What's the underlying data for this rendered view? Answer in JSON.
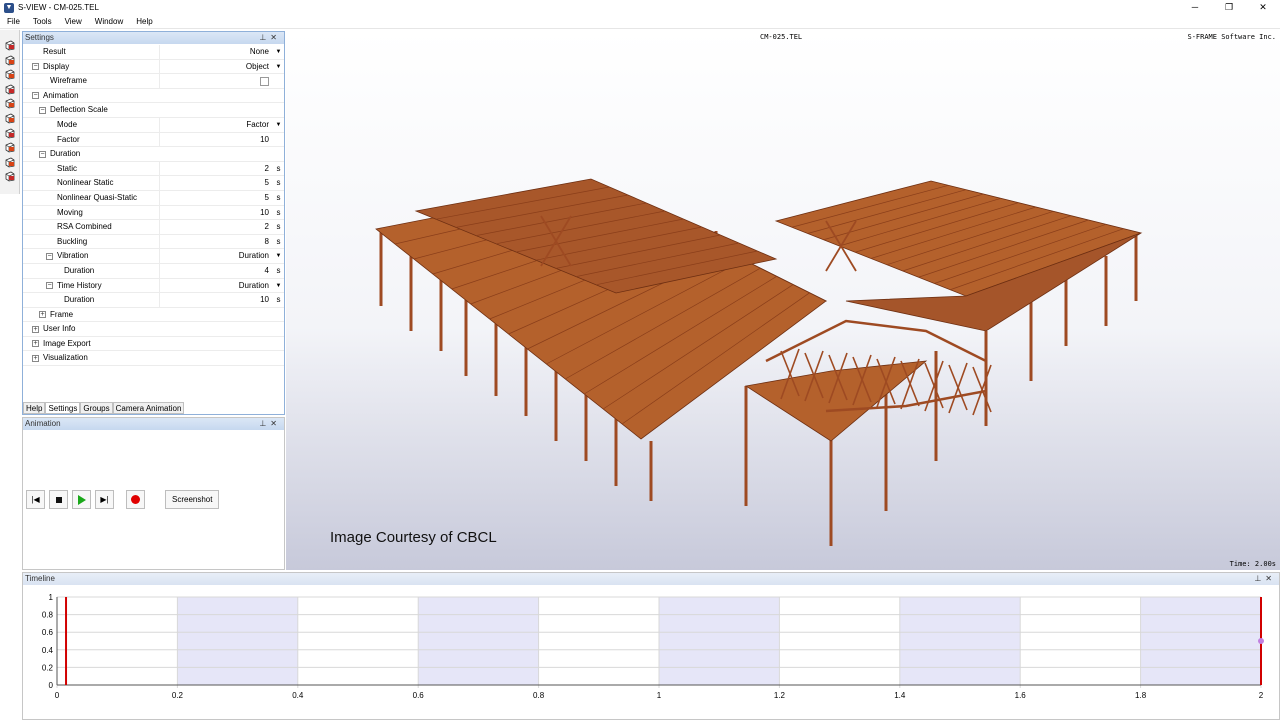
{
  "window": {
    "title": "S-VIEW - CM-025.TEL",
    "logo_icon": "sview-logo-icon"
  },
  "menu": [
    "File",
    "Tools",
    "View",
    "Window",
    "Help"
  ],
  "settings": {
    "title": "Settings",
    "rows": [
      {
        "name": "Result",
        "value": "None",
        "dropdown": true,
        "indent": 1,
        "type": "prop"
      },
      {
        "name": "Display",
        "value": "Object",
        "dropdown": true,
        "indent": 1,
        "type": "prop",
        "expander": "-"
      },
      {
        "name": "Wireframe",
        "value": "",
        "checkbox": true,
        "indent": 2,
        "type": "prop"
      },
      {
        "name": "Animation",
        "indent": 1,
        "type": "group",
        "expander": "-"
      },
      {
        "name": "Deflection Scale",
        "indent": 2,
        "type": "group",
        "expander": "-"
      },
      {
        "name": "Mode",
        "value": "Factor",
        "dropdown": true,
        "indent": 3,
        "type": "prop"
      },
      {
        "name": "Factor",
        "value": "10",
        "indent": 3,
        "type": "prop"
      },
      {
        "name": "Duration",
        "indent": 2,
        "type": "group",
        "expander": "-"
      },
      {
        "name": "Static",
        "value": "2",
        "unit": "s",
        "indent": 3,
        "type": "prop"
      },
      {
        "name": "Nonlinear Static",
        "value": "5",
        "unit": "s",
        "indent": 3,
        "type": "prop"
      },
      {
        "name": "Nonlinear Quasi-Static",
        "value": "5",
        "unit": "s",
        "indent": 3,
        "type": "prop"
      },
      {
        "name": "Moving",
        "value": "10",
        "unit": "s",
        "indent": 3,
        "type": "prop"
      },
      {
        "name": "RSA Combined",
        "value": "2",
        "unit": "s",
        "indent": 3,
        "type": "prop"
      },
      {
        "name": "Buckling",
        "value": "8",
        "unit": "s",
        "indent": 3,
        "type": "prop"
      },
      {
        "name": "Vibration",
        "value": "Duration",
        "dropdown": true,
        "indent": 3,
        "type": "prop",
        "expander": "-"
      },
      {
        "name": "Duration",
        "value": "4",
        "unit": "s",
        "indent": 4,
        "type": "prop"
      },
      {
        "name": "Time History",
        "value": "Duration",
        "dropdown": true,
        "indent": 3,
        "type": "prop",
        "expander": "-"
      },
      {
        "name": "Duration",
        "value": "10",
        "unit": "s",
        "indent": 4,
        "type": "prop"
      },
      {
        "name": "Frame",
        "indent": 2,
        "type": "group",
        "expander": "+"
      },
      {
        "name": "User Info",
        "indent": 1,
        "type": "group",
        "expander": "+"
      },
      {
        "name": "Image Export",
        "indent": 1,
        "type": "group",
        "expander": "+"
      },
      {
        "name": "Visualization",
        "indent": 1,
        "type": "group",
        "expander": "+"
      }
    ],
    "tabs": [
      "Help",
      "Settings",
      "Groups",
      "Camera Animation"
    ],
    "selected_tab": "Settings"
  },
  "animation": {
    "title": "Animation",
    "buttons": [
      "skip-to-start-icon",
      "stop-icon",
      "play-icon",
      "skip-to-end-icon",
      "record-icon"
    ],
    "screenshot_label": "Screenshot"
  },
  "viewport": {
    "file_label": "CM-025.TEL",
    "brand": "S-FRAME Software Inc.",
    "time": "Time: 2.00s",
    "credit": "Image Courtesy of CBCL"
  },
  "timeline": {
    "title": "Timeline",
    "x_ticks": [
      "0",
      "0.2",
      "0.4",
      "0.6",
      "0.8",
      "1",
      "1.2",
      "1.4",
      "1.6",
      "1.8",
      "2"
    ],
    "y_ticks": [
      "0",
      "0.2",
      "0.4",
      "0.6",
      "0.8",
      "1"
    ],
    "bands": [
      [
        0.2,
        0.4
      ],
      [
        0.6,
        0.8
      ],
      [
        1.0,
        1.2
      ],
      [
        1.4,
        1.6
      ],
      [
        1.8,
        2.0
      ]
    ],
    "marker_start": 0.015,
    "marker_end": 2.0,
    "point": {
      "x": 2.0,
      "y": 0.5
    }
  },
  "colors": {
    "band": "#e6e6f8",
    "marker": "#d10000",
    "steel": "#9e4a22",
    "deck": "#b4612c",
    "accent": "#8fb0d9",
    "point": "#c080e0",
    "play": "#1aa81a",
    "record": "#e00000"
  }
}
